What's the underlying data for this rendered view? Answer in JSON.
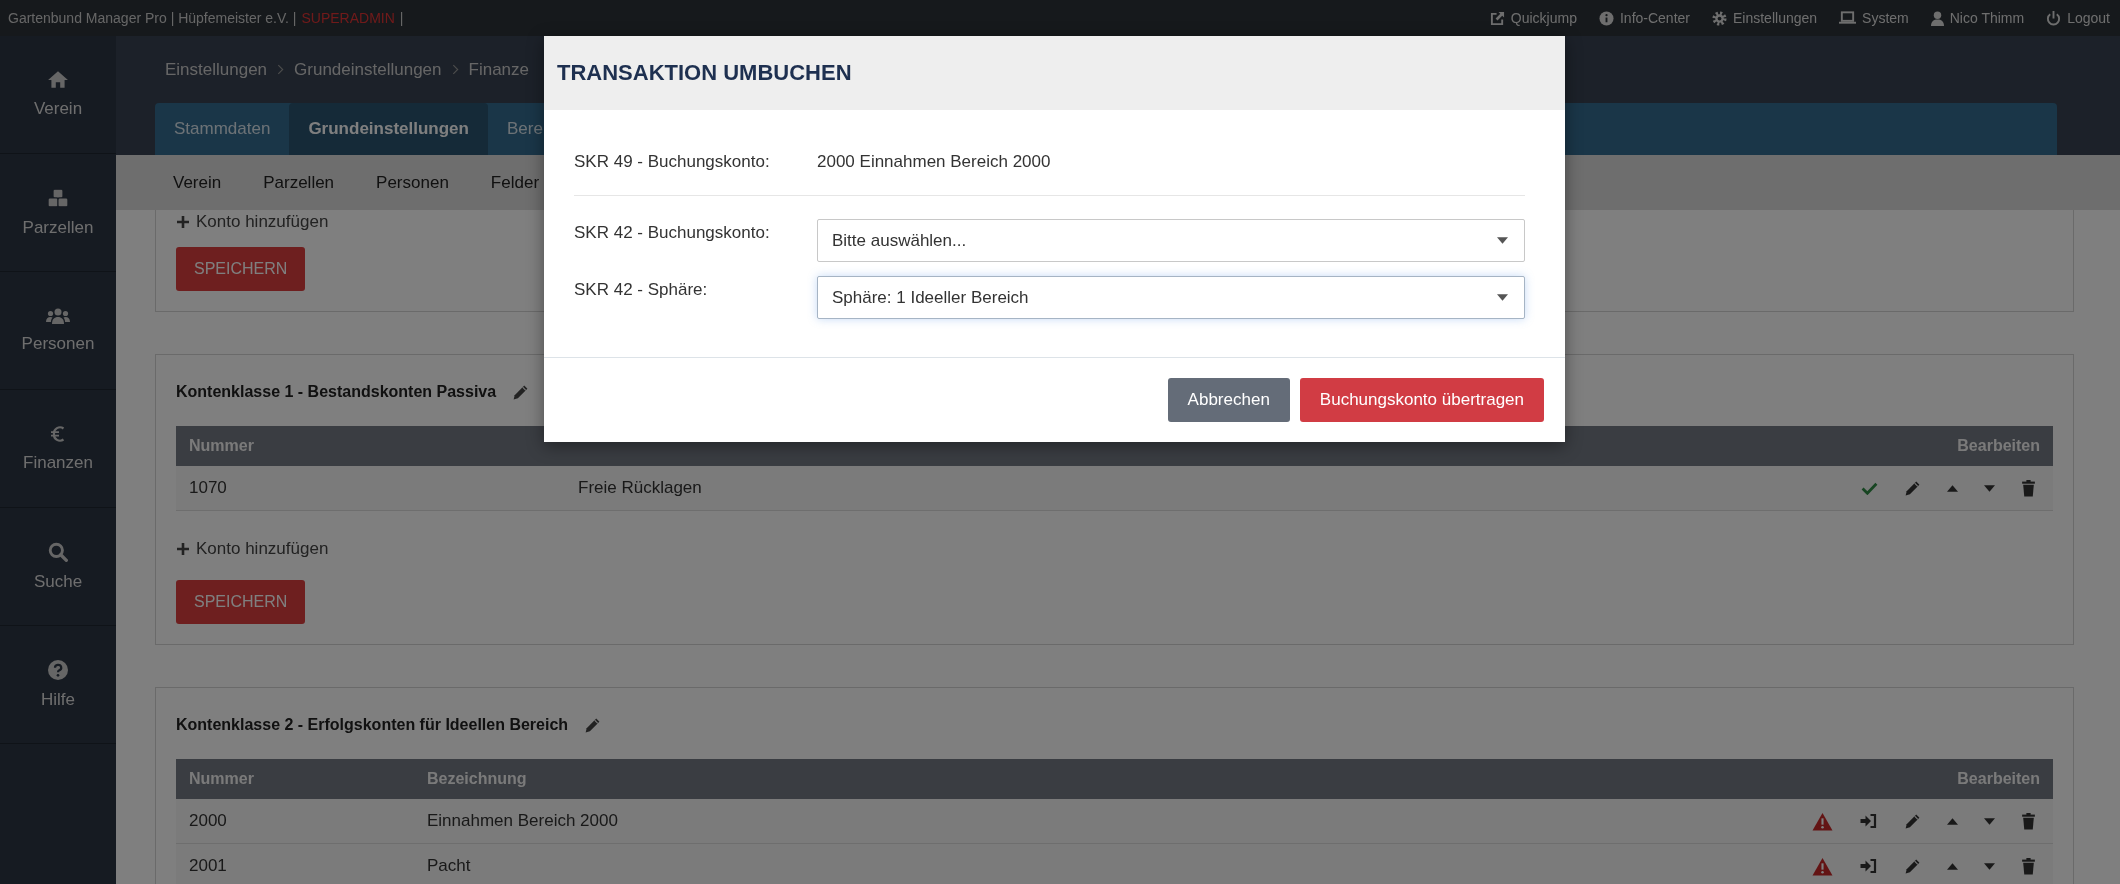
{
  "top_bar": {
    "app_title": "Gartenbund Manager Pro | Hüpfemeister e.V. |",
    "role": "SUPERADMIN",
    "separator": "|",
    "links": [
      {
        "label": "Quickjump"
      },
      {
        "label": "Info-Center"
      },
      {
        "label": "Einstellungen"
      },
      {
        "label": "System"
      },
      {
        "label": "Nico Thimm"
      },
      {
        "label": "Logout"
      }
    ]
  },
  "sidebar": {
    "items": [
      {
        "label": "Verein"
      },
      {
        "label": "Parzellen"
      },
      {
        "label": "Personen"
      },
      {
        "label": "Finanzen"
      },
      {
        "label": "Suche"
      },
      {
        "label": "Hilfe"
      }
    ]
  },
  "breadcrumb": [
    "Einstellungen",
    "Grundeinstellungen",
    "Finanze"
  ],
  "tabs": [
    {
      "label": "Stammdaten",
      "selected": false
    },
    {
      "label": "Grundeinstellungen",
      "selected": true
    },
    {
      "label": "Bere",
      "selected": false
    }
  ],
  "subnav": [
    "Verein",
    "Parzellen",
    "Personen",
    "Felder"
  ],
  "cards": [
    {
      "add_link": "Konto hinzufügen",
      "save_button": "SPEICHERN"
    },
    {
      "title": "Kontenklasse 1 - Bestandskonten Passiva",
      "table": {
        "columns": [
          {
            "label": "Nummer"
          },
          {},
          {
            "label": "Bearbeiten"
          }
        ],
        "rows": [
          {
            "cells": [
              "1070",
              "Freie Rücklagen"
            ],
            "warning": false
          }
        ]
      },
      "add_link": "Konto hinzufügen",
      "save_button": "SPEICHERN"
    },
    {
      "title": "Kontenklasse 2 - Erfolgskonten für Ideellen Bereich",
      "table": {
        "columns": [
          {
            "label": "Nummer"
          },
          {
            "label": "Bezeichnung"
          },
          {
            "label": "Bearbeiten"
          }
        ],
        "rows": [
          {
            "cells": [
              "2000",
              "Einnahmen Bereich 2000"
            ],
            "warning": true
          },
          {
            "cells": [
              "2001",
              "Pacht"
            ],
            "warning": true
          }
        ]
      }
    }
  ],
  "modal": {
    "title": "TRANSAKTION UMBUCHEN",
    "fields": [
      {
        "kind": "static",
        "label": "SKR 49 - Buchungskonto:",
        "value": "2000 Einnahmen Bereich 2000"
      },
      {
        "kind": "select",
        "label": "SKR 42 - Buchungskonto:",
        "placeholder": "Bitte auswählen...",
        "focused": false
      },
      {
        "kind": "select",
        "label": "SKR 42 - Sphäre:",
        "value": "Sphäre: 1 Ideeller Bereich",
        "focused": true
      }
    ],
    "buttons": [
      {
        "label": "Abbrechen",
        "kind": "secondary"
      },
      {
        "label": "Buchungskonto übertragen",
        "kind": "primary"
      }
    ]
  }
}
